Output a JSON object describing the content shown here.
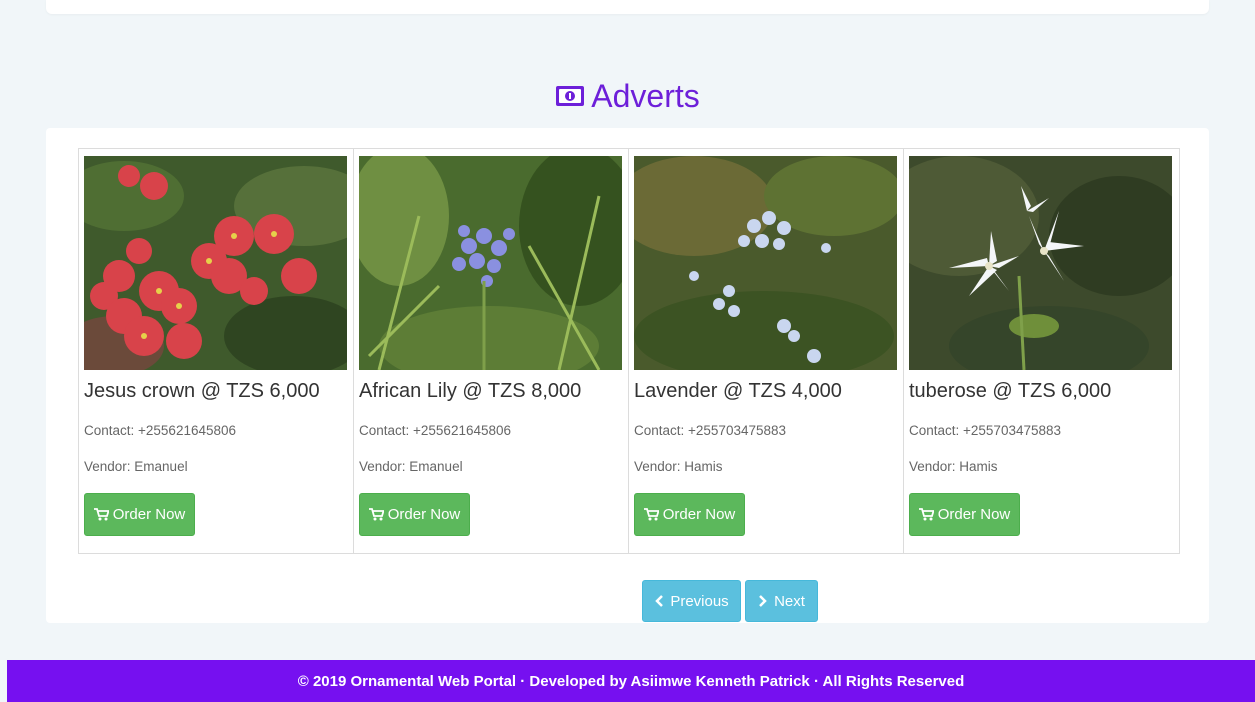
{
  "header": {
    "title": "Adverts",
    "icon": "money-bill-icon",
    "accent_color": "#6d1fd9"
  },
  "adverts": [
    {
      "title": "Jesus crown @ TZS 6,000",
      "contact": "Contact: +255621645806",
      "vendor": "Vendor: Emanuel",
      "button": "Order Now",
      "image": "red-flowers-photo"
    },
    {
      "title": "African Lily @ TZS 8,000",
      "contact": "Contact: +255621645806",
      "vendor": "Vendor: Emanuel",
      "button": "Order Now",
      "image": "blue-agapanthus-photo"
    },
    {
      "title": "Lavender @ TZS 4,000",
      "contact": "Contact: +255703475883",
      "vendor": "Vendor: Hamis",
      "button": "Order Now",
      "image": "pale-blue-flowers-photo"
    },
    {
      "title": "tuberose @ TZS 6,000",
      "contact": "Contact: +255703475883",
      "vendor": "Vendor: Hamis",
      "button": "Order Now",
      "image": "white-flowers-photo"
    }
  ],
  "pagination": {
    "previous": "Previous",
    "next": "Next"
  },
  "footer": {
    "text": "© 2019 Ornamental Web Portal · Developed by Asiimwe Kenneth Patrick · All Rights Reserved"
  },
  "colors": {
    "success": "#5cb85c",
    "info": "#5bc0de",
    "footer_bg": "#7610f0"
  }
}
